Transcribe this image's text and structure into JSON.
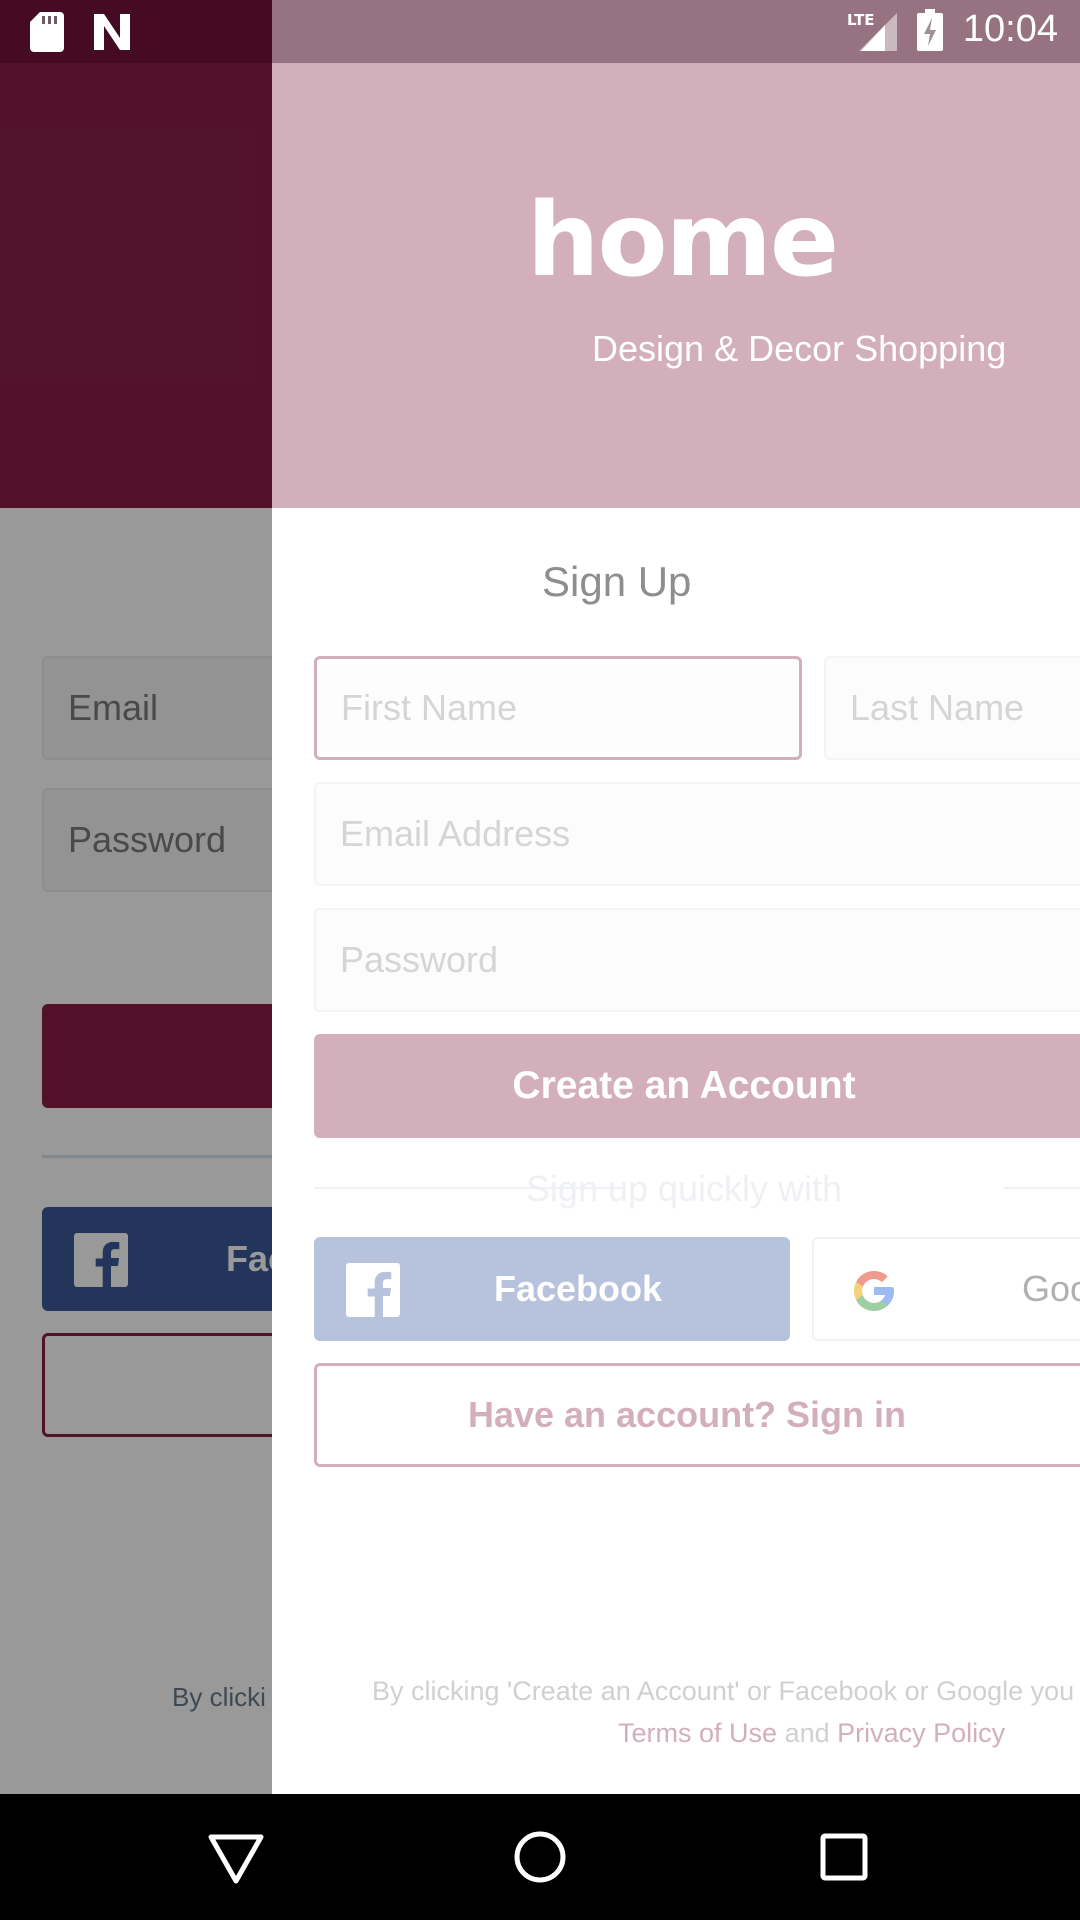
{
  "status_bar": {
    "time": "10:04",
    "network": "LTE"
  },
  "login_screen": {
    "email_placeholder": "Email",
    "password_placeholder": "Password",
    "facebook_label": "Fac",
    "terms_text": "By clicki"
  },
  "brand": {
    "logo": "home",
    "tagline": "Design & Decor Shopping"
  },
  "signup": {
    "title": "Sign Up",
    "first_name_placeholder": "First Name",
    "last_name_placeholder": "Last Name",
    "email_placeholder": "Email Address",
    "password_placeholder": "Password",
    "create_account_label": "Create an Account",
    "quick_signup_label": "Sign up quickly with",
    "facebook_label": "Facebook",
    "google_label": "Goo",
    "have_account_label": "Have an account? Sign in",
    "terms_text": "By clicking 'Create an Account' or Facebook or Google you",
    "terms_link": "Terms of Use",
    "terms_and": "and",
    "privacy_link": "Privacy Policy"
  },
  "colors": {
    "brand_primary": "#8a1f47",
    "brand_faded": "#d3afbc",
    "facebook": "#3b5998"
  }
}
